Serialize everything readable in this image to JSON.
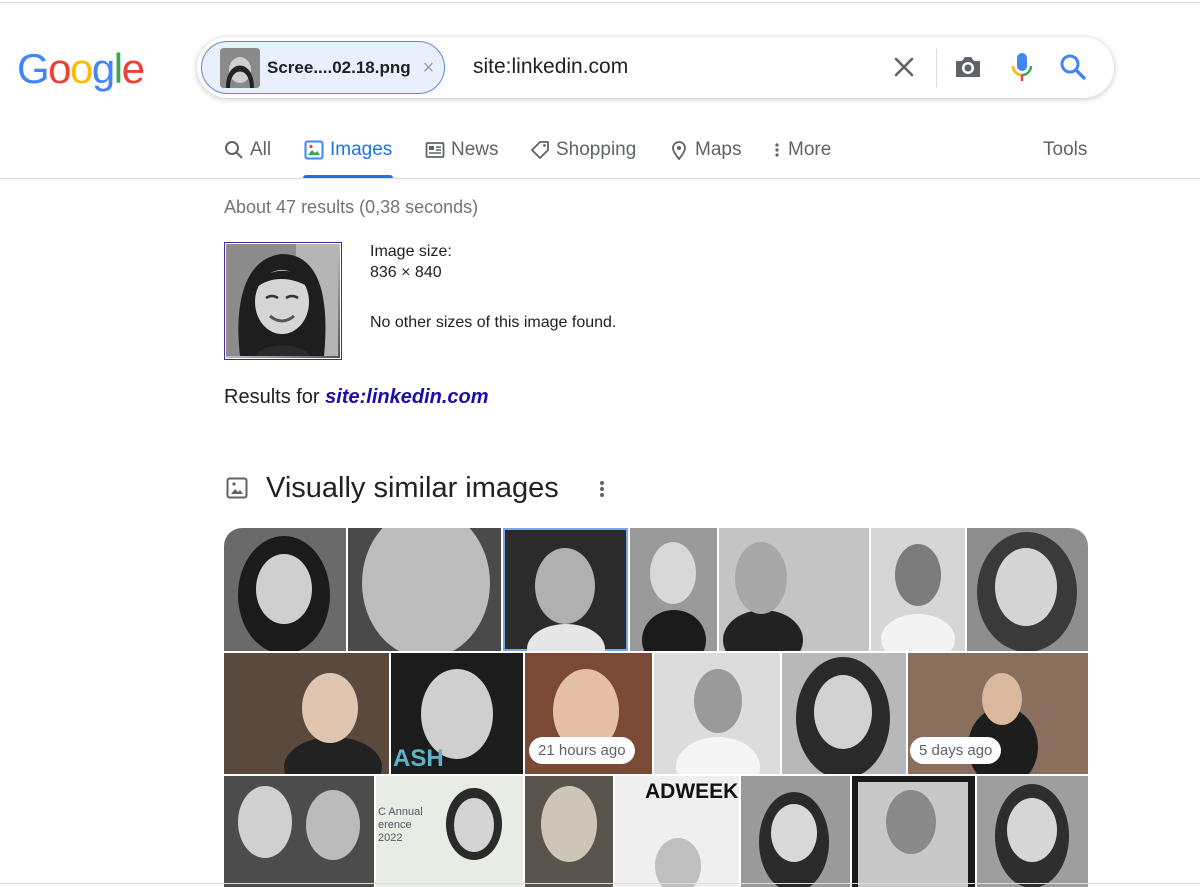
{
  "logo": {
    "letters": [
      "G",
      "o",
      "o",
      "g",
      "l",
      "e"
    ],
    "colors": [
      "#4285f4",
      "#ea4335",
      "#fbbc05",
      "#4285f4",
      "#34a853",
      "#ea4335"
    ]
  },
  "search": {
    "chip_name": "Scree....02.18.png",
    "chip_close": "×",
    "query": "site:linkedin.com",
    "icons": [
      "close-icon",
      "camera-icon",
      "mic-icon",
      "search-icon"
    ]
  },
  "tabs": [
    {
      "label": "All",
      "icon": "search-icon"
    },
    {
      "label": "Images",
      "icon": "image-icon",
      "active": true
    },
    {
      "label": "News",
      "icon": "news-icon"
    },
    {
      "label": "Shopping",
      "icon": "tag-icon"
    },
    {
      "label": "Maps",
      "icon": "pin-icon"
    },
    {
      "label": "More",
      "icon": "more-vert-icon"
    }
  ],
  "tools_label": "Tools",
  "stats": "About 47 results (0,38 seconds)",
  "image_info": {
    "size_label": "Image size:",
    "size_value": "836 × 840",
    "no_other": "No other sizes of this image found."
  },
  "results_for": {
    "prefix": "Results for",
    "link": "site:linkedin.com"
  },
  "similar": {
    "title": "Visually similar images",
    "badges": [
      "21 hours ago",
      "5 days ago"
    ]
  },
  "colors": {
    "accent": "#1a73e8",
    "link": "#1a0dab"
  }
}
